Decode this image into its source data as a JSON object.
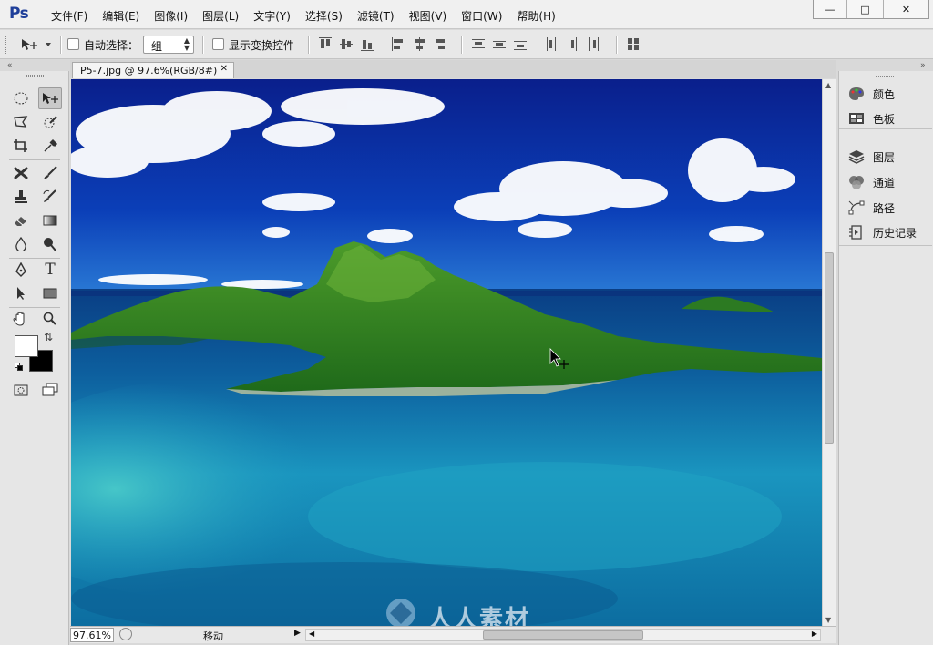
{
  "app": {
    "logo": "Ps"
  },
  "menu": [
    "文件(F)",
    "编辑(E)",
    "图像(I)",
    "图层(L)",
    "文字(Y)",
    "选择(S)",
    "滤镜(T)",
    "视图(V)",
    "窗口(W)",
    "帮助(H)"
  ],
  "window_controls": {
    "minimize": "—",
    "maximize": "□",
    "close": "✕"
  },
  "options": {
    "auto_select_label": "自动选择：",
    "auto_select_checked": false,
    "auto_select_value": "组",
    "show_transform_label": "显示变换控件",
    "show_transform_checked": false
  },
  "collapse_glyph": "«",
  "document": {
    "tab_title": "P5-7.jpg @ 97.6%(RGB/8#)",
    "close_glyph": "✕"
  },
  "status": {
    "zoom": "97.61%",
    "mode": "移动"
  },
  "tools": [
    {
      "name": "move",
      "icon": "move-icon",
      "selected": true
    },
    {
      "name": "elliptical-marquee",
      "icon": "ellipse-marquee-icon"
    },
    {
      "name": "polygonal-lasso",
      "icon": "lasso-icon"
    },
    {
      "name": "quick-selection",
      "icon": "quick-select-icon"
    },
    {
      "name": "crop",
      "icon": "crop-icon"
    },
    {
      "name": "eyedropper",
      "icon": "eyedropper-icon"
    },
    {
      "name": "spot-healing",
      "icon": "healing-icon"
    },
    {
      "name": "brush",
      "icon": "brush-icon"
    },
    {
      "name": "clone-stamp",
      "icon": "stamp-icon"
    },
    {
      "name": "history-brush",
      "icon": "history-brush-icon"
    },
    {
      "name": "eraser",
      "icon": "eraser-icon"
    },
    {
      "name": "gradient",
      "icon": "gradient-icon"
    },
    {
      "name": "blur",
      "icon": "blur-icon"
    },
    {
      "name": "dodge",
      "icon": "dodge-icon"
    },
    {
      "name": "pen",
      "icon": "pen-icon"
    },
    {
      "name": "type",
      "icon": "type-icon",
      "glyph": "T"
    },
    {
      "name": "path-selection",
      "icon": "path-select-icon"
    },
    {
      "name": "rectangle",
      "icon": "rectangle-icon"
    },
    {
      "name": "hand",
      "icon": "hand-icon"
    },
    {
      "name": "zoom",
      "icon": "zoom-icon"
    }
  ],
  "colors": {
    "foreground": "#ffffff",
    "background": "#000000"
  },
  "panels": {
    "group1": [
      {
        "label": "颜色",
        "icon": "palette-icon"
      },
      {
        "label": "色板",
        "icon": "swatches-icon"
      }
    ],
    "group2": [
      {
        "label": "图层",
        "icon": "layers-icon"
      },
      {
        "label": "通道",
        "icon": "channels-icon"
      },
      {
        "label": "路径",
        "icon": "paths-icon"
      },
      {
        "label": "历史记录",
        "icon": "history-icon"
      }
    ]
  },
  "watermark": "人人素材",
  "theme": {
    "logo_color": "#1f3f9a",
    "sky": "#0a2a9a",
    "sea": "#1a8fb8",
    "land": "#2f7d1f"
  }
}
